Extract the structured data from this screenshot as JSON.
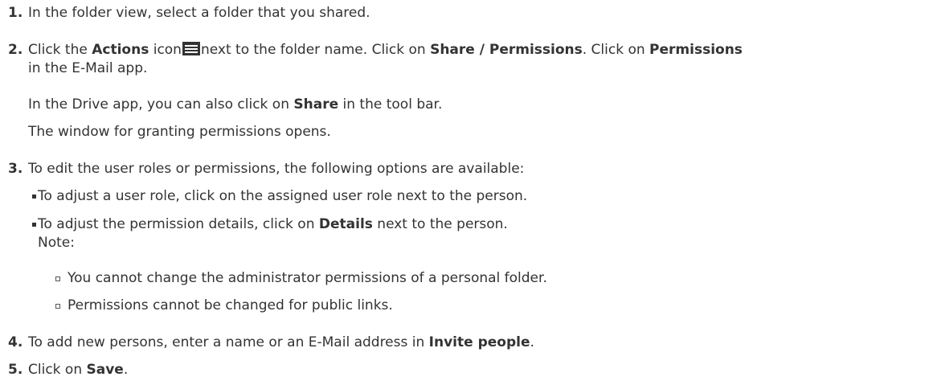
{
  "steps": [
    {
      "number": "1.",
      "text": "In the folder view, select a folder that you shared."
    },
    {
      "number": "2.",
      "a": "Click the ",
      "b1": "Actions",
      "c": " icon",
      "d": "next to the folder name. Click on ",
      "b2": "Share / Permissions",
      "e": ". Click on ",
      "b3": "Permissions",
      "line2": "in the E-Mail app.",
      "drive_a": "In the Drive app, you can also click on ",
      "drive_b": "Share",
      "drive_c": " in the tool bar.",
      "window_line": "The window for granting permissions opens."
    },
    {
      "number": "3.",
      "text": "To edit the user roles or permissions, the following options are available:",
      "bullet1": "To adjust a user role, click on the assigned user role next to the person.",
      "bullet2_a": "To adjust the permission details, click on ",
      "bullet2_b": "Details",
      "bullet2_c": " next to the person.",
      "note": "Note:",
      "sub1": "You cannot change the administrator permissions of a personal folder.",
      "sub2": "Permissions cannot be changed for public links."
    },
    {
      "number": "4.",
      "a": "To add new persons, enter a name or an E-Mail address in ",
      "b": "Invite people",
      "c": "."
    },
    {
      "number": "5.",
      "a": "Click on ",
      "b": "Save",
      "c": "."
    }
  ],
  "icons": {
    "actions": "actions-menu-icon"
  },
  "colors": {
    "text": "#333333"
  }
}
